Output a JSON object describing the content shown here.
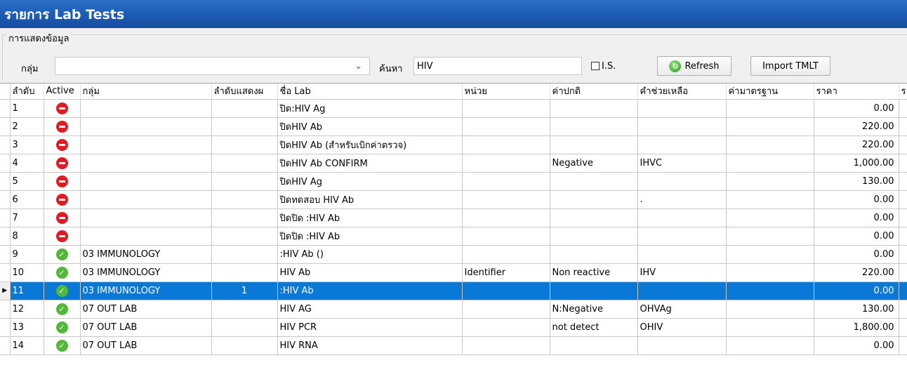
{
  "window": {
    "title": "รายการ Lab Tests"
  },
  "filter": {
    "legend": "การแสดงข้อมูล",
    "group_label": "กลุ่ม",
    "group_value": "",
    "search_label": "ค้นหา",
    "search_value": "HIV",
    "is_label": "I.S.",
    "refresh_label": "Refresh",
    "import_label": "Import TMLT"
  },
  "grid": {
    "columns": [
      "ลำดับ",
      "Active",
      "กลุ่ม",
      "ลำดับแสดงผ",
      "ชื่อ Lab",
      "หน่วย",
      "ค่าปกติ",
      "คำช่วยเหลือ",
      "ค่ามาตรฐาน",
      "ราคา",
      "ร"
    ],
    "rows": [
      {
        "no": "1",
        "active": false,
        "group": "",
        "order": "",
        "name": "ปิด:HIV Ag",
        "unit": "",
        "normal": "",
        "help": "",
        "std": "",
        "price": "0.00"
      },
      {
        "no": "2",
        "active": false,
        "group": "",
        "order": "",
        "name": "ปิดHIV Ab",
        "unit": "",
        "normal": "",
        "help": "",
        "std": "",
        "price": "220.00"
      },
      {
        "no": "3",
        "active": false,
        "group": "",
        "order": "",
        "name": "ปิดHIV Ab (สำหรับเบิกค่าตรวจ)",
        "unit": "",
        "normal": "",
        "help": "",
        "std": "",
        "price": "220.00"
      },
      {
        "no": "4",
        "active": false,
        "group": "",
        "order": "",
        "name": "ปิดHIV Ab CONFIRM",
        "unit": "",
        "normal": "Negative",
        "help": "IHVC",
        "std": "",
        "price": "1,000.00"
      },
      {
        "no": "5",
        "active": false,
        "group": "",
        "order": "",
        "name": "ปิดHIV Ag",
        "unit": "",
        "normal": "",
        "help": "",
        "std": "",
        "price": "130.00"
      },
      {
        "no": "6",
        "active": false,
        "group": "",
        "order": "",
        "name": "ปิดทดสอบ HIV Ab",
        "unit": "",
        "normal": "",
        "help": ".",
        "std": "",
        "price": "0.00"
      },
      {
        "no": "7",
        "active": false,
        "group": "",
        "order": "",
        "name": "ปิดปิด :HIV Ab",
        "unit": "",
        "normal": "",
        "help": "",
        "std": "",
        "price": "0.00"
      },
      {
        "no": "8",
        "active": false,
        "group": "",
        "order": "",
        "name": "ปิดปิด :HIV Ab",
        "unit": "",
        "normal": "",
        "help": "",
        "std": "",
        "price": "0.00"
      },
      {
        "no": "9",
        "active": true,
        "group": "03 IMMUNOLOGY",
        "order": "",
        "name": ":HIV Ab ()",
        "unit": "",
        "normal": "",
        "help": "",
        "std": "",
        "price": "0.00"
      },
      {
        "no": "10",
        "active": true,
        "group": "03 IMMUNOLOGY",
        "order": "",
        "name": "HIV Ab",
        "unit": "Identifier",
        "normal": "Non reactive",
        "help": "IHV",
        "std": "",
        "price": "220.00"
      },
      {
        "no": "11",
        "active": true,
        "group": "03 IMMUNOLOGY",
        "order": "1",
        "name": ":HIV Ab",
        "unit": "",
        "normal": "",
        "help": "",
        "std": "",
        "price": "0.00",
        "selected": true
      },
      {
        "no": "12",
        "active": true,
        "group": "07 OUT LAB",
        "order": "",
        "name": "HIV AG",
        "unit": "",
        "normal": "N:Negative",
        "help": "OHVAg",
        "std": "",
        "price": "130.00"
      },
      {
        "no": "13",
        "active": true,
        "group": "07 OUT LAB",
        "order": "",
        "name": "HIV PCR",
        "unit": "",
        "normal": "not detect",
        "help": "OHIV",
        "std": "",
        "price": "1,800.00"
      },
      {
        "no": "14",
        "active": true,
        "group": "07 OUT LAB",
        "order": "",
        "name": "HIV RNA",
        "unit": "",
        "normal": "",
        "help": "",
        "std": "",
        "price": "0.00"
      }
    ]
  }
}
